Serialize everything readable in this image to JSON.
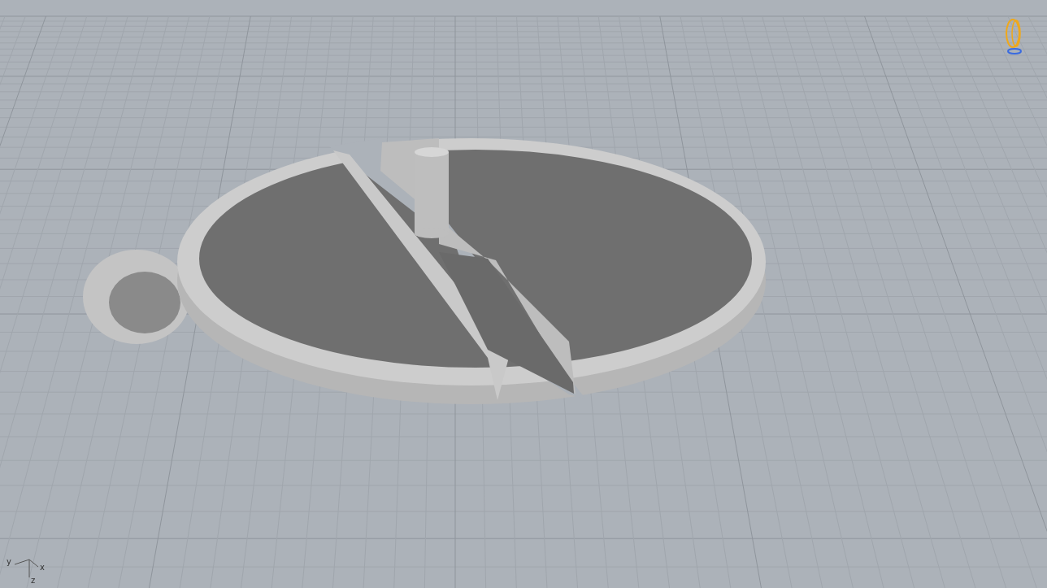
{
  "viewport": {
    "kind": "perspective",
    "axes": [
      {
        "label": "y"
      },
      {
        "label": "x"
      },
      {
        "label": "z"
      }
    ]
  }
}
